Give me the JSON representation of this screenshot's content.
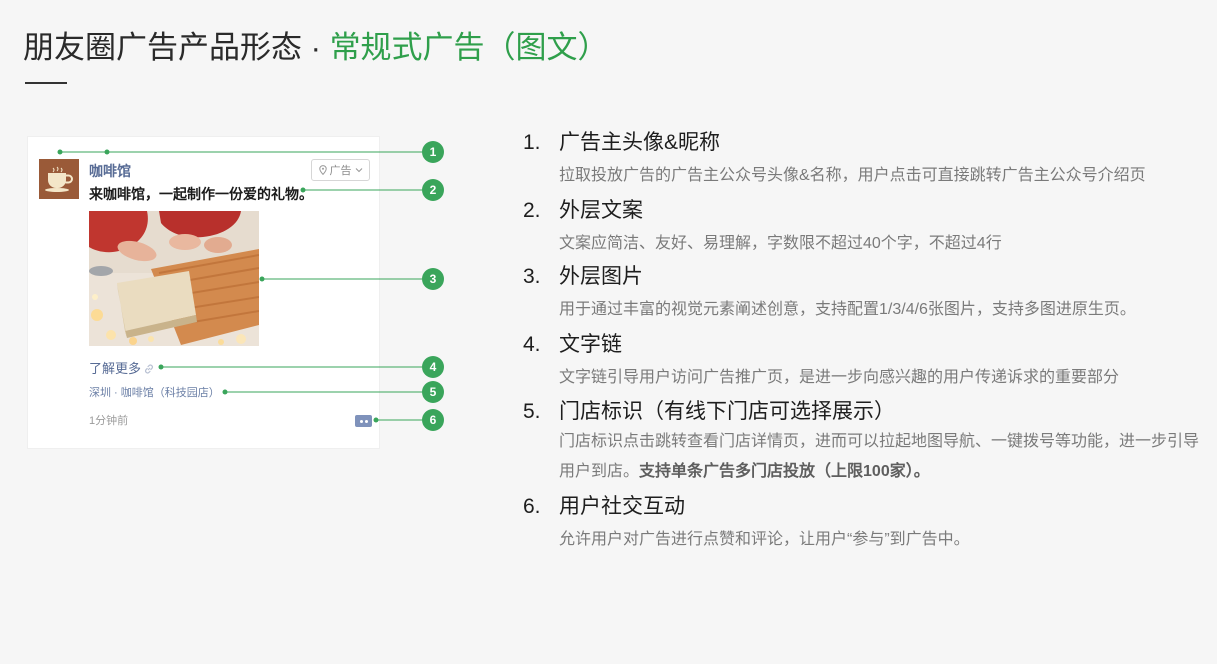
{
  "title": {
    "prefix": "朋友圈广告产品形态 · ",
    "highlight": "常规式广告（图文）"
  },
  "colors": {
    "accent": "#2f9f4b",
    "callout_green": "#3aa55b",
    "link_blue": "#576b95",
    "avatar_brown": "#9a5a38",
    "comment_button": "#7f92bb"
  },
  "ad_card": {
    "avatar_icon": "coffee-cup-icon",
    "advertiser_name": "咖啡馆",
    "ad_tag": {
      "icon": "location-pin-icon",
      "label": "广告",
      "dropdown_icon": "chevron-down-icon"
    },
    "copy_text": "来咖啡馆，一起制作一份爱的礼物。",
    "text_link": {
      "label": "了解更多",
      "icon": "link-icon"
    },
    "store_location": "深圳 · 咖啡馆（科技园店）",
    "timestamp": "1分钟前",
    "comment_icon": "comment-icon"
  },
  "callouts": [
    "1",
    "2",
    "3",
    "4",
    "5",
    "6"
  ],
  "features": [
    {
      "number": "1.",
      "heading": "广告主头像&昵称",
      "description": "拉取投放广告的广告主公众号头像&名称，用户点击可直接跳转广告主公众号介绍页"
    },
    {
      "number": "2.",
      "heading": "外层文案",
      "description": "文案应简洁、友好、易理解，字数限不超过40个字，不超过4行"
    },
    {
      "number": "3.",
      "heading": "外层图片",
      "description": "用于通过丰富的视觉元素阐述创意，支持配置1/3/4/6张图片，支持多图进原生页。"
    },
    {
      "number": "4.",
      "heading": "文字链",
      "description": "文字链引导用户访问广告推广页，是进一步向感兴趣的用户传递诉求的重要部分"
    },
    {
      "number": "5.",
      "heading": "门店标识（有线下门店可选择展示）",
      "description": "门店标识点击跳转查看门店详情页，进而可以拉起地图导航、一键拨号等功能，进一步引导用户到店。",
      "description_bold": "支持单条广告多门店投放（上限100家）。"
    },
    {
      "number": "6.",
      "heading": "用户社交互动",
      "description": "允许用户对广告进行点赞和评论，让用户“参与”到广告中。"
    }
  ]
}
